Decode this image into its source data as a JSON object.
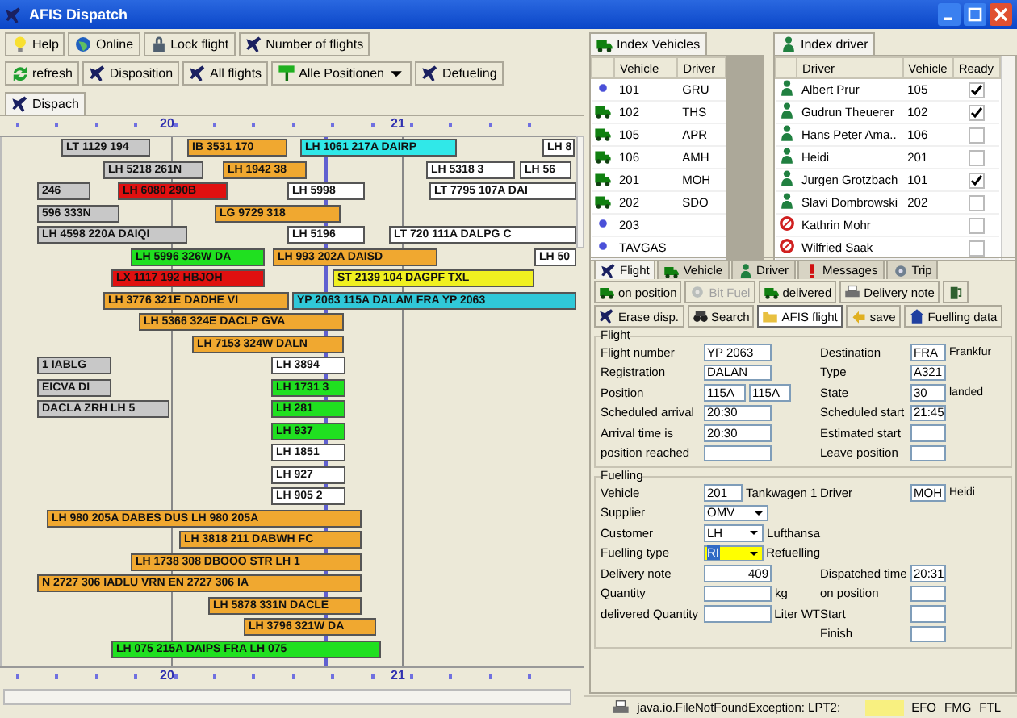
{
  "window": {
    "title": "AFIS Dispatch"
  },
  "toolbar_1": [
    {
      "label": "Help"
    },
    {
      "label": "Online"
    },
    {
      "label": "Lock flight"
    },
    {
      "label": "Number of flights"
    }
  ],
  "toolbar_2": [
    {
      "label": "refresh",
      "kind": "button"
    },
    {
      "label": "Disposition",
      "kind": "button"
    },
    {
      "label": "All flights",
      "kind": "button"
    },
    {
      "label": "Alle Positionen",
      "kind": "dropdown"
    },
    {
      "label": "Defueling",
      "kind": "button"
    }
  ],
  "main_tabs": [
    {
      "label": "Dispach",
      "selected": true
    }
  ],
  "gantt": {
    "top_axis": {
      "hours": [
        "20",
        "21"
      ]
    },
    "bottom_axis": {
      "hours": [
        "20",
        "21"
      ]
    },
    "rows": [
      {
        "bars": [
          {
            "label": "LT 1129 194",
            "color": "#c8c8c8"
          },
          {
            "label": "IB 3531 170",
            "color": "#f0a830"
          },
          {
            "label": "LH 1061 217A DAIRP",
            "color": "#30e8e8"
          },
          {
            "label": "LH 8",
            "color": "#ffffff"
          }
        ]
      },
      {
        "bars": [
          {
            "label": "LH 5218 261N",
            "color": "#c8c8c8"
          },
          {
            "label": "LH 1942 38",
            "color": "#f0a830"
          },
          {
            "label": "LH 5318 3",
            "color": "#ffffff"
          },
          {
            "label": "LH 56",
            "color": "#ffffff"
          }
        ]
      },
      {
        "bars": [
          {
            "label": "246",
            "color": "#c8c8c8"
          },
          {
            "label": "LH 6080 290B",
            "color": "#e01010"
          },
          {
            "label": "LH 5998",
            "color": "#ffffff"
          },
          {
            "label": "LT 7795 107A DAI",
            "color": "#ffffff"
          }
        ]
      },
      {
        "bars": [
          {
            "label": "596 333N",
            "color": "#c8c8c8"
          },
          {
            "label": "LG 9729 318",
            "color": "#f0a830"
          }
        ]
      },
      {
        "bars": [
          {
            "label": "LH 4598 220A DAIQI",
            "color": "#c8c8c8"
          },
          {
            "label": "LH 5196",
            "color": "#ffffff"
          },
          {
            "label": "LT 720 111A DALPG C",
            "color": "#ffffff"
          }
        ]
      },
      {
        "bars": [
          {
            "label": "LH 5996 326W DA",
            "color": "#20e020"
          },
          {
            "label": "LH 993 202A DAISD",
            "color": "#f0a830"
          },
          {
            "label": "LH 50",
            "color": "#ffffff"
          }
        ]
      },
      {
        "bars": [
          {
            "label": "LX 1117 192 HBJOH",
            "color": "#e01010"
          },
          {
            "label": "ST 2139 104 DAGPF TXL",
            "color": "#f0f020"
          }
        ]
      },
      {
        "bars": [
          {
            "label": "LH 3776 321E DADHE VI",
            "color": "#f0a830"
          },
          {
            "label": "YP 2063 115A DALAM FRA YP 2063",
            "color": "#30c8d8"
          }
        ]
      },
      {
        "bars": [
          {
            "label": "LH 5366 324E DACLP GVA",
            "color": "#f0a830"
          }
        ]
      },
      {
        "bars": [
          {
            "label": "LH 7153 324W DALN",
            "color": "#f0a830"
          }
        ]
      },
      {
        "bars": [
          {
            "label": "1 IABLG",
            "color": "#c8c8c8"
          },
          {
            "label": "LH 3894",
            "color": "#ffffff"
          }
        ]
      },
      {
        "bars": [
          {
            "label": "EICVA DI",
            "color": "#c8c8c8"
          },
          {
            "label": "LH 1731 3",
            "color": "#20e020"
          }
        ]
      },
      {
        "bars": [
          {
            "label": "DACLA ZRH LH 5",
            "color": "#c8c8c8"
          },
          {
            "label": "LH 281",
            "color": "#20e020"
          }
        ]
      },
      {
        "bars": [
          {
            "label": "LH 937",
            "color": "#20e020"
          }
        ]
      },
      {
        "bars": [
          {
            "label": "LH 1851",
            "color": "#ffffff"
          }
        ]
      },
      {
        "bars": [
          {
            "label": "LH 927",
            "color": "#ffffff"
          }
        ]
      },
      {
        "bars": [
          {
            "label": "LH 905 2",
            "color": "#ffffff"
          }
        ]
      },
      {
        "bars": [
          {
            "label": "LH 980 205A DABES DUS LH 980 205A",
            "color": "#f0a830"
          }
        ]
      },
      {
        "bars": [
          {
            "label": "LH 3818 211 DABWH FC",
            "color": "#f0a830"
          }
        ]
      },
      {
        "bars": [
          {
            "label": "LH 1738 308 DBOOO STR LH 1",
            "color": "#f0a830"
          }
        ]
      },
      {
        "bars": [
          {
            "label": "N 2727 306 IADLU VRN EN 2727 306 IA",
            "color": "#f0a830"
          }
        ]
      },
      {
        "bars": [
          {
            "label": "LH 5878 331N DACLE",
            "color": "#f0a830"
          }
        ]
      },
      {
        "bars": [
          {
            "label": "LH 3796 321W DA",
            "color": "#f0a830"
          }
        ]
      },
      {
        "bars": [
          {
            "label": "LH 075 215A DAIPS FRA LH 075",
            "color": "#20e020"
          }
        ]
      }
    ]
  },
  "vehicles": {
    "tab": {
      "label": "Index Vehicles",
      "selected": true
    },
    "columns": [
      "Vehicle",
      "Driver"
    ],
    "rows": [
      {
        "vehicle": "101",
        "driver": "GRU",
        "assigned": false
      },
      {
        "vehicle": "102",
        "driver": "THS",
        "assigned": true
      },
      {
        "vehicle": "105",
        "driver": "APR",
        "assigned": true
      },
      {
        "vehicle": "106",
        "driver": "AMH",
        "assigned": true
      },
      {
        "vehicle": "201",
        "driver": "MOH",
        "assigned": true
      },
      {
        "vehicle": "202",
        "driver": "SDO",
        "assigned": true
      },
      {
        "vehicle": "203",
        "assigned": false
      },
      {
        "vehicle": "TAVGAS",
        "assigned": false
      }
    ]
  },
  "drivers": {
    "tab": {
      "label": "Index driver",
      "selected": true
    },
    "columns": [
      "Driver",
      "Vehicle",
      "Ready"
    ],
    "rows": [
      {
        "driver": "Albert Prur",
        "vehicle": "105",
        "ready": true,
        "available": true
      },
      {
        "driver": "Gudrun Theuerer",
        "vehicle": "102",
        "ready": true,
        "available": true
      },
      {
        "driver": "Hans Peter Ama..",
        "vehicle": "106",
        "ready": false,
        "available": true
      },
      {
        "driver": "Heidi",
        "vehicle": "201",
        "ready": false,
        "available": true
      },
      {
        "driver": "Jurgen Grotzbach",
        "vehicle": "101",
        "ready": true,
        "available": true
      },
      {
        "driver": "Slavi Dombrowski",
        "vehicle": "202",
        "ready": false,
        "available": true
      },
      {
        "driver": "Kathrin Mohr",
        "ready": false,
        "available": false
      },
      {
        "driver": "Wilfried Saak",
        "ready": false,
        "available": false
      }
    ]
  },
  "detail_tabs": [
    {
      "label": "Flight",
      "selected": true
    },
    {
      "label": "Vehicle",
      "selected": false
    },
    {
      "label": "Driver",
      "selected": false
    },
    {
      "label": "Messages",
      "selected": false
    },
    {
      "label": "Trip",
      "selected": false
    }
  ],
  "detail_toolbar_1": [
    {
      "kind": "text",
      "label": "on position",
      "disabled": false
    },
    {
      "kind": "text",
      "label": "Bit Fuel",
      "disabled": true
    },
    {
      "kind": "text",
      "label": "delivered",
      "disabled": false
    },
    {
      "kind": "text",
      "label": "Delivery note",
      "disabled": false
    },
    {
      "kind": "icon",
      "disabled": false
    }
  ],
  "detail_toolbar_2": [
    {
      "label": "Erase disp.",
      "selected": false
    },
    {
      "label": "Search",
      "selected": false
    },
    {
      "label": "AFIS flight",
      "selected": true
    },
    {
      "label": "save",
      "selected": false
    },
    {
      "label": "Fuelling data",
      "selected": false
    }
  ],
  "flight_group": {
    "title": "Flight",
    "rows": [
      {
        "left": {
          "label": "Flight number",
          "inputs": [
            {
              "kind": "text",
              "value": "YP 2063"
            }
          ]
        },
        "right": {
          "label": "Destination",
          "inputs": [
            {
              "kind": "text",
              "value": "FRA"
            }
          ],
          "note": "Frankfur"
        }
      },
      {
        "left": {
          "label": "Registration",
          "inputs": [
            {
              "kind": "text",
              "value": "DALAN"
            }
          ]
        },
        "right": {
          "label": "Type",
          "inputs": [
            {
              "kind": "text",
              "value": "A321"
            }
          ]
        }
      },
      {
        "left": {
          "label": "Position",
          "inputs": [
            {
              "kind": "text",
              "value": "115A"
            },
            {
              "kind": "text",
              "value": "115A"
            }
          ]
        },
        "right": {
          "label": "State",
          "inputs": [
            {
              "kind": "text",
              "value": "30"
            }
          ],
          "note": "landed"
        }
      },
      {
        "left": {
          "label": "Scheduled arrival",
          "inputs": [
            {
              "kind": "text",
              "value": "20:30"
            }
          ]
        },
        "right": {
          "label": "Scheduled start",
          "inputs": [
            {
              "kind": "text",
              "value": "21:45"
            }
          ]
        }
      },
      {
        "left": {
          "label": "Arrival time is",
          "inputs": [
            {
              "kind": "text",
              "value": "20:30"
            }
          ]
        },
        "right": {
          "label": "Estimated start",
          "inputs": [
            {
              "kind": "text"
            }
          ]
        }
      },
      {
        "left": {
          "label": "position reached",
          "inputs": [
            {
              "kind": "text"
            }
          ]
        },
        "right": {
          "label": "Leave position",
          "inputs": [
            {
              "kind": "text"
            }
          ]
        }
      }
    ]
  },
  "fuelling_group": {
    "title": "Fuelling",
    "rows": [
      {
        "left": {
          "label": "Vehicle",
          "inputs": [
            {
              "kind": "text",
              "value": "201"
            }
          ],
          "note": "Tankwagen 1"
        },
        "right": {
          "label": "Driver",
          "inputs": [
            {
              "kind": "text",
              "value": "MOH"
            }
          ],
          "note": "Heidi"
        }
      },
      {
        "left": {
          "label": "Supplier",
          "inputs": [
            {
              "kind": "select",
              "value": "OMV",
              "highlighted": false
            }
          ]
        }
      },
      {
        "left": {
          "label": "Customer",
          "inputs": [
            {
              "kind": "select",
              "value": "LH",
              "highlighted": false
            }
          ],
          "note": "Lufthansa"
        }
      },
      {
        "left": {
          "label": "Fuelling type",
          "inputs": [
            {
              "kind": "select",
              "value": "RI",
              "highlighted": true
            }
          ],
          "note": "Refuelling"
        }
      },
      {
        "left": {
          "label": "Delivery note",
          "inputs": [
            {
              "kind": "number",
              "value": "409"
            }
          ]
        },
        "right": {
          "label": "Dispatched time",
          "inputs": [
            {
              "kind": "text",
              "value": "20:31"
            }
          ]
        }
      },
      {
        "left": {
          "label": "Quantity",
          "inputs": [
            {
              "kind": "number"
            }
          ],
          "note": "kg"
        },
        "right": {
          "label": "on position",
          "inputs": [
            {
              "kind": "text"
            }
          ]
        }
      },
      {
        "left": {
          "label": "delivered Quantity",
          "inputs": [
            {
              "kind": "number"
            }
          ],
          "note": "Liter WT"
        },
        "right": {
          "label": "Start",
          "inputs": [
            {
              "kind": "text"
            }
          ]
        }
      },
      {
        "right": {
          "label": "Finish",
          "inputs": [
            {
              "kind": "text"
            }
          ]
        }
      }
    ]
  },
  "status_bar": {
    "message": "java.io.FileNotFoundException: LPT2:",
    "codes": [
      "EFO",
      "FMG",
      "FTL"
    ]
  }
}
